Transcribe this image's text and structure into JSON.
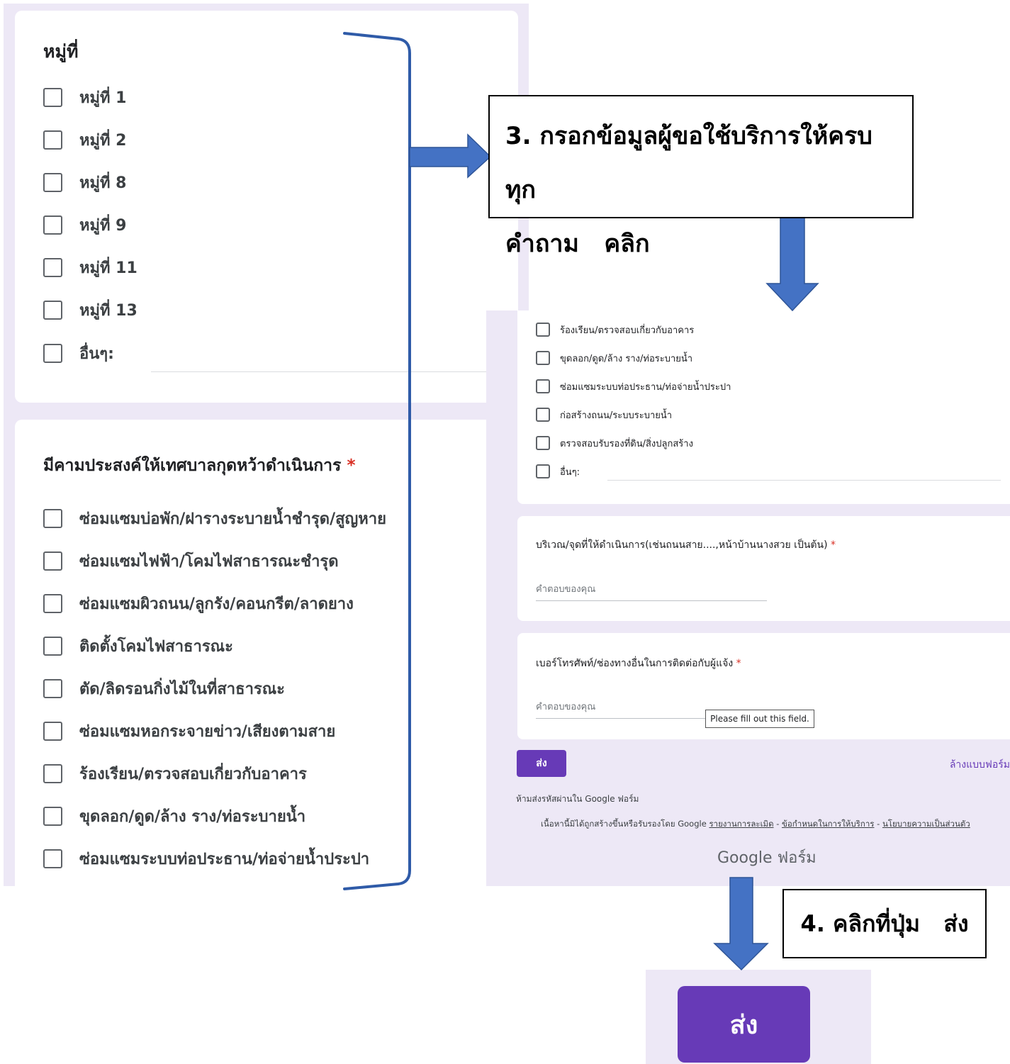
{
  "left_form": {
    "village_question": {
      "title": "หมู่ที่"
    },
    "village_options": [
      "หมู่ที่ 1",
      "หมู่ที่ 2",
      "หมู่ที่ 8",
      "หมู่ที่ 9",
      "หมู่ที่ 11",
      "หมู่ที่ 13"
    ],
    "village_other_label": "อื่นๆ:",
    "service_question": {
      "title": "มีคามประสงค์ให้เทศบาลกุดหว้าดำเนินการ",
      "required_mark": "*"
    },
    "service_options": [
      "ซ่อมแซมบ่อพัก/ฝารางระบายน้ำชำรุด/สูญหาย",
      "ซ่อมแซมไฟฟ้า/โคมไฟสาธารณะชำรุด",
      "ซ่อมแซมผิวถนน/ลูกรัง/คอนกรีต/ลาดยาง",
      "ติดตั้งโคมไฟสาธารณะ",
      "ตัด/ลิดรอนกิ่งไม้ในที่สาธารณะ",
      "ซ่อมแซมหอกระจายข่าว/เสียงตามสาย",
      "ร้องเรียน/ตรวจสอบเกี่ยวกับอาคาร",
      "ขุดลอก/ดูด/ล้าง  ราง/ท่อระบายน้ำ",
      "ซ่อมแซมระบบท่อประธาน/ท่อจ่ายน้ำประปา"
    ]
  },
  "callouts": {
    "step3_line1": "3. กรอกข้อมูลผู้ขอใช้บริการให้ครบทุก",
    "step3_line2": "คำถาม   คลิก",
    "step4": "4. คลิกที่ปุ่ม   ส่ง"
  },
  "right_form": {
    "service_options": [
      "ร้องเรียน/ตรวจสอบเกี่ยวกับอาคาร",
      "ขุดลอก/ดูด/ล้าง  ราง/ท่อระบายน้ำ",
      "ซ่อมแซมระบบท่อประธาน/ท่อจ่ายน้ำประปา",
      "ก่อสร้างถนน/ระบบระบายน้ำ",
      "ตรวจสอบรับรองที่ดิน/สิ่งปลูกสร้าง"
    ],
    "other_label": "อื่นๆ:",
    "location_question": "บริเวณ/จุดที่ให้ดำเนินการ(เช่นถนนสาย....,หน้าบ้านนางสวย เป็นต้น)",
    "phone_question": "เบอร์โทรศัพท์/ช่องทางอื่นในการติดต่อกับผู้แจ้ง",
    "required_mark": "*",
    "answer_placeholder": "คำตอบของคุณ",
    "tooltip": "Please fill out this field.",
    "submit_label": "ส่ง",
    "clear_label": "ล้างแบบฟอร์ม",
    "never_submit": "ห้ามส่งรหัสผ่านใน Google ฟอร์ม",
    "footer_text": "เนื้อหานี้มิได้ถูกสร้างขึ้นหรือรับรองโดย Google",
    "footer_link_abuse": "รายงานการละเมิด",
    "footer_link_terms": "ข้อกำหนดในการให้บริการ",
    "footer_link_privacy": "นโยบายความเป็นส่วนตัว",
    "footer_sep": " - ",
    "brand": "Google ฟอร์ม"
  },
  "zoom": {
    "submit_label": "ส่ง"
  },
  "colors": {
    "accent": "#673ab7",
    "arrow": "#4472c4",
    "required": "#d93025",
    "form_bg": "#ede8f6"
  }
}
